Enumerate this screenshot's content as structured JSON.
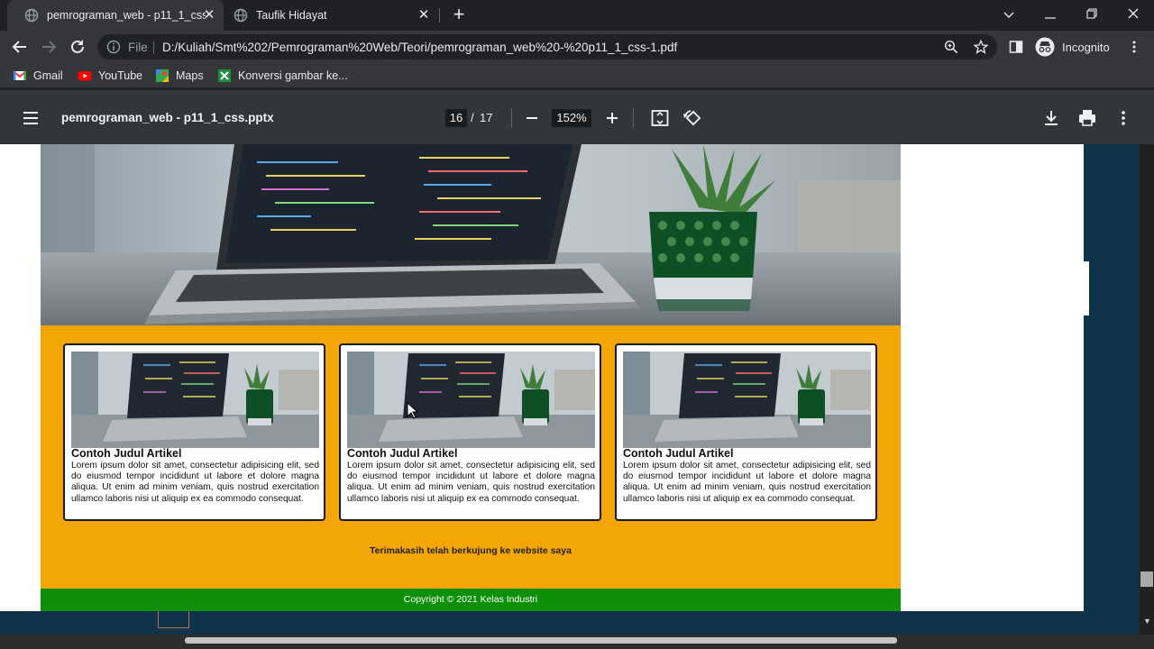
{
  "tabs": [
    {
      "title": "pemrograman_web - p11_1_css.p",
      "icon": "globe-icon",
      "active": true
    },
    {
      "title": "Taufik Hidayat",
      "icon": "globe-icon",
      "active": false
    }
  ],
  "toolbar": {
    "file_label": "File",
    "url": "D:/Kuliah/Smt%202/Pemrograman%20Web/Teori/pemrograman_web%20-%20p11_1_css-1.pdf",
    "profile_label": "Incognito"
  },
  "bookmarks": [
    {
      "label": "Gmail",
      "icon": "gmail-icon"
    },
    {
      "label": "YouTube",
      "icon": "youtube-icon"
    },
    {
      "label": "Maps",
      "icon": "maps-icon"
    },
    {
      "label": "Konversi gambar ke...",
      "icon": "sheets-icon"
    }
  ],
  "pdf": {
    "title": "pemrograman_web - p11_1_css.pptx",
    "current_page": "16",
    "page_separator": "/",
    "total_pages": "17",
    "zoom": "152%"
  },
  "page": {
    "articles": [
      {
        "title": "Contoh Judul Artikel",
        "body": "Lorem ipsum dolor sit amet, consectetur adipisicing elit, sed do eiusmod tempor incididunt ut labore et dolore magna aliqua. Ut enim ad minim veniam, quis nostrud exercitation ullamco laboris nisi ut aliquip ex ea commodo consequat."
      },
      {
        "title": "Contoh Judul Artikel",
        "body": "Lorem ipsum dolor sit amet, consectetur adipisicing elit, sed do eiusmod tempor incididunt ut labore et dolore magna aliqua. Ut enim ad minim veniam, quis nostrud exercitation ullamco laboris nisi ut aliquip ex ea commodo consequat."
      },
      {
        "title": "Contoh Judul Artikel",
        "body": "Lorem ipsum dolor sit amet, consectetur adipisicing elit, sed do eiusmod tempor incididunt ut labore et dolore magna aliqua. Ut enim ad minim veniam, quis nostrud exercitation ullamco laboris nisi ut aliquip ex ea commodo consequat."
      }
    ],
    "thanks": "Terimakasih telah berkujung ke website saya",
    "footer": "Copyright © 2021 Kelas Industri"
  },
  "colors": {
    "content_background": "#f4a607",
    "footer_background": "#0e8f0a",
    "viewer_background": "#0f3348"
  }
}
